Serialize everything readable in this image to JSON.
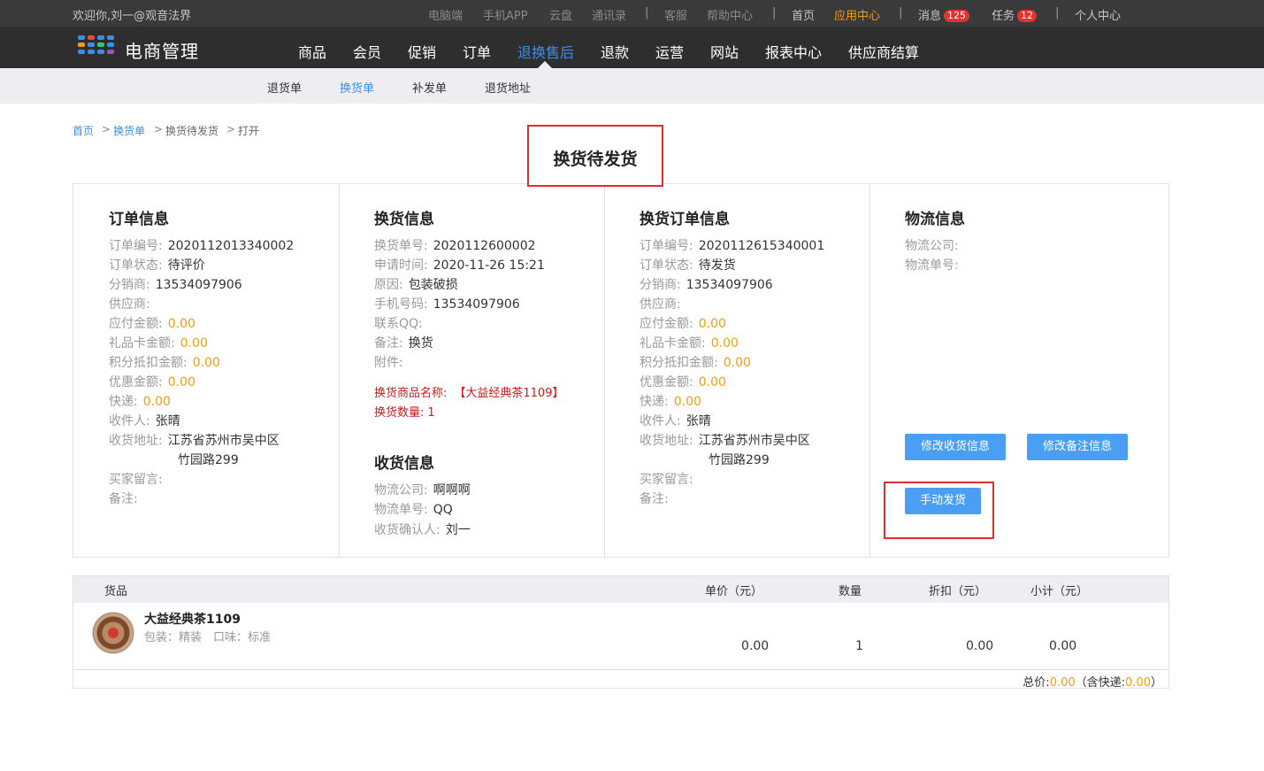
{
  "topbar": {
    "welcome": "欢迎你,刘一@观音法界",
    "links": [
      "电脑端",
      "手机APP",
      "云盘",
      "通讯录",
      "客服",
      "帮助中心",
      "首页",
      "应用中心",
      "消息",
      "任务",
      "个人中心"
    ],
    "message_count": "125",
    "task_count": "12",
    "separator": "|"
  },
  "brand": {
    "title": "电商管理"
  },
  "main_nav": [
    "商品",
    "会员",
    "促销",
    "订单",
    "退换售后",
    "退款",
    "运营",
    "网站",
    "报表中心",
    "供应商结算"
  ],
  "sub_nav": [
    "退货单",
    "换货单",
    "补发单",
    "退货地址"
  ],
  "breadcrumb": [
    "首页",
    "换货单",
    "换货待发货",
    "打开"
  ],
  "breadcrumb_sep": ">",
  "page_title": "换货待发货",
  "order_info": {
    "title": "订单信息",
    "rows": [
      {
        "k": "订单编号:",
        "v": "2020112013340002"
      },
      {
        "k": "订单状态:",
        "v": "待评价"
      },
      {
        "k": "分销商:",
        "v": "13534097906"
      },
      {
        "k": "供应商:",
        "v": ""
      },
      {
        "k": "应付金额:",
        "v": "0.00"
      },
      {
        "k": "礼品卡金额:",
        "v": "0.00"
      },
      {
        "k": "积分抵扣金额:",
        "v": "0.00"
      },
      {
        "k": "优惠金额:",
        "v": "0.00"
      },
      {
        "k": "快递:",
        "v": "0.00"
      },
      {
        "k": "收件人:",
        "v": "张晴"
      },
      {
        "k": "收货地址:",
        "v": "江苏省苏州市吴中区",
        "v2": "竹园路299"
      },
      {
        "k": "买家留言:",
        "v": ""
      },
      {
        "k": "备注:",
        "v": ""
      }
    ]
  },
  "exchange_info": {
    "title": "换货信息",
    "rows": [
      {
        "k": "换货单号:",
        "v": "2020112600002"
      },
      {
        "k": "申请时间:",
        "v": "2020-11-26 15:21"
      },
      {
        "k": "原因:",
        "v": "包装破损"
      },
      {
        "k": "手机号码:",
        "v": "13534097906"
      },
      {
        "k": "联系QQ:",
        "v": ""
      },
      {
        "k": "备注:",
        "v": "换货"
      },
      {
        "k": "附件:",
        "v": ""
      }
    ],
    "goods_name_label": "换货商品名称:",
    "goods_name": "【大益经典茶1109】",
    "goods_qty_label": "换货数量:",
    "goods_qty": "1"
  },
  "receive_info": {
    "title": "收货信息",
    "rows": [
      {
        "k": "物流公司:",
        "v": "啊啊啊"
      },
      {
        "k": "物流单号:",
        "v": "QQ"
      },
      {
        "k": "收货确认人:",
        "v": "刘一"
      }
    ]
  },
  "exchange_order_info": {
    "title": "换货订单信息",
    "rows": [
      {
        "k": "订单编号:",
        "v": "2020112615340001"
      },
      {
        "k": "订单状态:",
        "v": "待发货"
      },
      {
        "k": "分销商:",
        "v": "13534097906"
      },
      {
        "k": "供应商:",
        "v": ""
      },
      {
        "k": "应付金额:",
        "v": "0.00"
      },
      {
        "k": "礼品卡金额:",
        "v": "0.00"
      },
      {
        "k": "积分抵扣金额:",
        "v": "0.00"
      },
      {
        "k": "优惠金额:",
        "v": "0.00"
      },
      {
        "k": "快递:",
        "v": "0.00"
      },
      {
        "k": "收件人:",
        "v": "张晴"
      },
      {
        "k": "收货地址:",
        "v": "江苏省苏州市吴中区",
        "v2": "竹园路299"
      },
      {
        "k": "买家留言:",
        "v": ""
      },
      {
        "k": "备注:",
        "v": ""
      }
    ]
  },
  "logistics_info": {
    "title": "物流信息",
    "rows": [
      {
        "k": "物流公司:",
        "v": ""
      },
      {
        "k": "物流单号:",
        "v": ""
      }
    ]
  },
  "buttons": {
    "edit_receive": "修改收货信息",
    "edit_remark": "修改备注信息",
    "manual_ship": "手动发货"
  },
  "goods_table": {
    "headers": [
      "货品",
      "单价（元）",
      "数量",
      "折扣（元）",
      "小计（元）"
    ],
    "item": {
      "name": "大益经典茶1109",
      "spec": "包装：精装　口味：标准",
      "price": "0.00",
      "qty": "1",
      "discount": "0.00",
      "subtotal": "0.00"
    },
    "total_label": "总价:",
    "total": "0.00",
    "shipping_label": "（含快递:",
    "shipping": "0.00",
    "close_paren": "）"
  },
  "colors": {
    "accent": "#3d8ee8",
    "amount": "#f39c12",
    "highlight_border": "#e02c2c",
    "button": "#4a9ff5",
    "topbar": "#2e2e2e"
  }
}
